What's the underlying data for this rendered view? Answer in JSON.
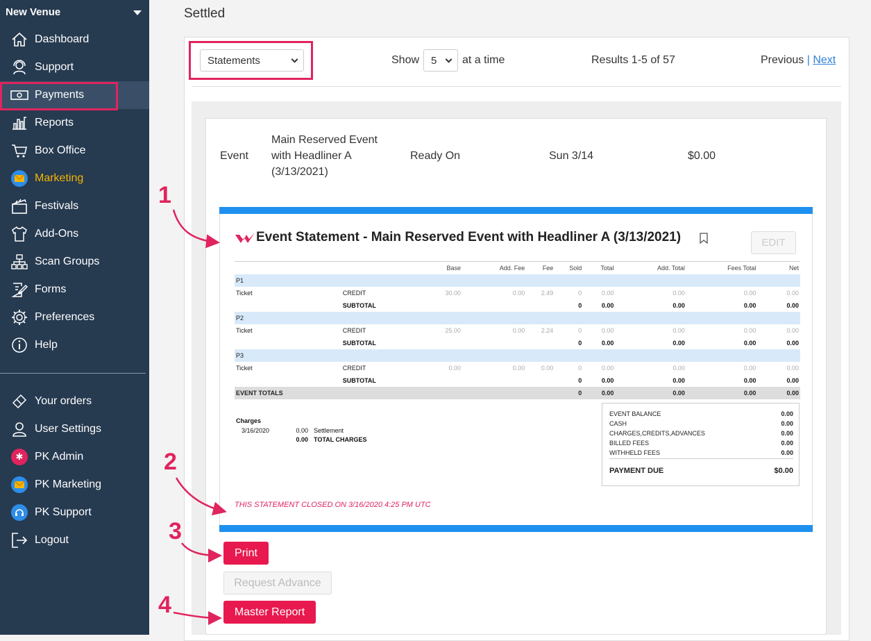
{
  "sidebar": {
    "venue": "New Venue",
    "items": [
      {
        "label": "Dashboard",
        "icon": "home-icon"
      },
      {
        "label": "Support",
        "icon": "headset-icon"
      },
      {
        "label": "Payments",
        "icon": "money-icon"
      },
      {
        "label": "Reports",
        "icon": "bar-chart-icon"
      },
      {
        "label": "Box Office",
        "icon": "cart-icon"
      },
      {
        "label": "Marketing",
        "icon": "mail-icon"
      },
      {
        "label": "Festivals",
        "icon": "clapper-icon"
      },
      {
        "label": "Add-Ons",
        "icon": "tshirt-icon"
      },
      {
        "label": "Scan Groups",
        "icon": "sitemap-icon"
      },
      {
        "label": "Forms",
        "icon": "form-icon"
      },
      {
        "label": "Preferences",
        "icon": "gear-icon"
      },
      {
        "label": "Help",
        "icon": "info-icon"
      }
    ],
    "bottom_items": [
      {
        "label": "Your orders",
        "icon": "ticket-icon"
      },
      {
        "label": "User Settings",
        "icon": "user-icon"
      },
      {
        "label": "PK Admin",
        "icon": "admin-gear-icon"
      },
      {
        "label": "PK Marketing",
        "icon": "mail-icon"
      },
      {
        "label": "PK Support",
        "icon": "headset-icon"
      },
      {
        "label": "Logout",
        "icon": "logout-icon"
      }
    ]
  },
  "page": {
    "title": "Settled",
    "filter_select": "Statements",
    "show_label": "Show",
    "page_size": "5",
    "at_a_time": "at a time",
    "results": "Results 1-5 of 57",
    "previous": "Previous",
    "pager_sep": "|",
    "next": "Next"
  },
  "event": {
    "type_label": "Event",
    "name_line1": "Main Reserved Event",
    "name_line2": "with Headliner A",
    "name_line3": "(3/13/2021)",
    "ready_label": "Ready On",
    "ready_date": "Sun 3/14",
    "amount": "$0.00"
  },
  "statement": {
    "title": "Event Statement - Main Reserved Event with Headliner A (3/13/2021)",
    "edit_label": "EDIT",
    "columns": [
      "Base",
      "Add. Fee",
      "Fee",
      "Sold",
      "Total",
      "Add. Total",
      "Fees Total",
      "Net"
    ],
    "groups": [
      {
        "name": "P1",
        "ticket": "Ticket",
        "method": "CREDIT",
        "values": [
          "30.00",
          "0.00",
          "2.49",
          "0",
          "0.00",
          "0.00",
          "0.00",
          "0.00"
        ],
        "subtotal_label": "SUBTOTAL",
        "subtotal": [
          "0",
          "0.00",
          "0.00",
          "0.00",
          "0.00"
        ]
      },
      {
        "name": "P2",
        "ticket": "Ticket",
        "method": "CREDIT",
        "values": [
          "25.00",
          "0.00",
          "2.24",
          "0",
          "0.00",
          "0.00",
          "0.00",
          "0.00"
        ],
        "subtotal_label": "SUBTOTAL",
        "subtotal": [
          "0",
          "0.00",
          "0.00",
          "0.00",
          "0.00"
        ]
      },
      {
        "name": "P3",
        "ticket": "Ticket",
        "method": "CREDIT",
        "values": [
          "0.00",
          "0.00",
          "0.00",
          "0",
          "0.00",
          "0.00",
          "0.00",
          "0.00"
        ],
        "subtotal_label": "SUBTOTAL",
        "subtotal": [
          "0",
          "0.00",
          "0.00",
          "0.00",
          "0.00"
        ]
      }
    ],
    "totals_label": "EVENT TOTALS",
    "totals": [
      "0",
      "0.00",
      "0.00",
      "0.00",
      "0.00"
    ],
    "charges": {
      "heading": "Charges",
      "date": "3/16/2020",
      "amount": "0.00",
      "desc": "Settlement",
      "total_amount": "0.00",
      "total_label": "TOTAL CHARGES"
    },
    "summary": [
      {
        "label": "EVENT BALANCE",
        "value": "0.00"
      },
      {
        "label": "CASH",
        "value": "0.00"
      },
      {
        "label": "CHARGES,CREDITS,ADVANCES",
        "value": "0.00"
      },
      {
        "label": "BILLED FEES",
        "value": "0.00"
      },
      {
        "label": "WITHHELD FEES",
        "value": "0.00"
      }
    ],
    "payment_due_label": "PAYMENT DUE",
    "payment_due": "$0.00",
    "closed_note": "THIS STATEMENT CLOSED ON 3/16/2020 4:25 PM UTC"
  },
  "buttons": {
    "print": "Print",
    "request_advance": "Request Advance",
    "master_report": "Master Report"
  },
  "annotations": [
    "1",
    "2",
    "3",
    "4"
  ],
  "colors": {
    "accent": "#e8194f",
    "sidebar": "#263a50",
    "blue_bar": "#1e90ef",
    "marketing": "#f4b400"
  }
}
